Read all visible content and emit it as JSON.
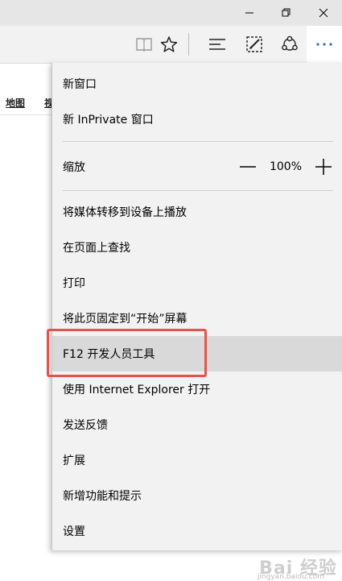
{
  "page_links": {
    "map": "地图",
    "partial": "视"
  },
  "menu": {
    "items": [
      {
        "key": "new_window",
        "label": "新窗口"
      },
      {
        "key": "new_inprivate",
        "label": "新 InPrivate 窗口"
      },
      {
        "key": "cast",
        "label": "将媒体转移到设备上播放"
      },
      {
        "key": "find",
        "label": "在页面上查找"
      },
      {
        "key": "print",
        "label": "打印"
      },
      {
        "key": "pin_start",
        "label": "将此页固定到“开始”屏幕"
      },
      {
        "key": "f12",
        "label": "F12 开发人员工具"
      },
      {
        "key": "open_ie",
        "label": "使用 Internet Explorer 打开"
      },
      {
        "key": "feedback",
        "label": "发送反馈"
      },
      {
        "key": "extensions",
        "label": "扩展"
      },
      {
        "key": "whats_new",
        "label": "新增功能和提示"
      },
      {
        "key": "settings",
        "label": "设置"
      }
    ],
    "zoom": {
      "label": "缩放",
      "value": "100%"
    }
  },
  "watermark": {
    "text": "Bai 经验",
    "sub": "jingyan.baidu.com"
  },
  "colors": {
    "highlight_box": "#e0554f",
    "menu_bg": "#f2f2f2",
    "hover_bg": "#d9d9d9"
  }
}
